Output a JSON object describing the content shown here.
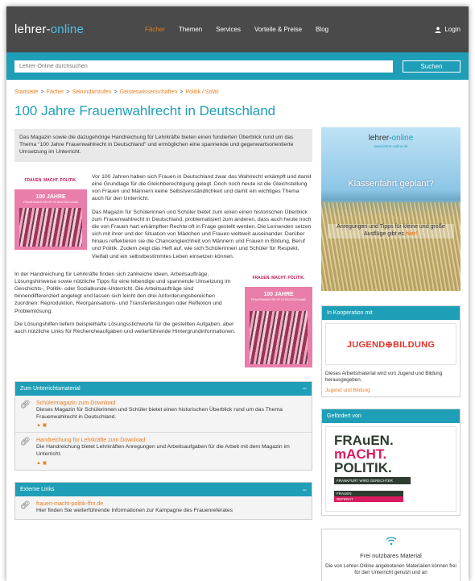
{
  "header": {
    "logo_part1": "lehrer-",
    "logo_part2": "online",
    "nav": [
      "Fächer",
      "Themen",
      "Services",
      "Vorteile & Preise",
      "Blog"
    ],
    "login_label": "Login"
  },
  "search": {
    "placeholder": "Lehrer-Online durchsuchen",
    "button_label": "Suchen"
  },
  "breadcrumb": [
    "Startseite",
    "Fächer",
    "Sekundarstufen",
    "Geisteswissenschaften",
    "Politik / SoWi"
  ],
  "page_title": "100 Jahre Frauenwahlrecht in Deutschland",
  "intro": "Das Magazin sowie die dazugehörige Handreichung für Lehrkräfte bieten einen fundierten Überblick rund um das Thema \"100 Jahre Frauenwahlrecht in Deutschland\" und ermöglichen eine spannende und gegenwartsorientierte Umsetzung im Unterricht.",
  "cover": {
    "logo": "FRAUEN. MACHT. POLITIK.",
    "title": "100 JAHRE",
    "subtitle": "FRAUENWAHLRECHT IN DEUTSCHLAND"
  },
  "paragraphs": [
    "Vor 100 Jahren haben sich Frauen in Deutschland zwar das Wahlrecht erkämpft und damit eine Grundlage für die Gleichberechtigung gelegt. Doch noch heute ist die Gleichstellung von Frauen und Männern keine Selbstverständlichkeit und damit ein wichtiges Thema auch für den Unterricht.",
    "Das Magazin für Schülerinnen und Schüler bietet zum einen einen historischen Überblick zum Frauenwahlrecht in Deutschland, problematisiert zum anderen, dass auch heute noch die von Frauen hart erkämpften Rechte oft in Frage gestellt werden. Die Lernenden setzen sich mit ihrer und der Situation von Mädchen und Frauen weltweit auseinander. Darüber hinaus reflektieren sie die Chancengleichheit von Männern und Frauen in Bildung, Beruf und Politik. Zudem zeigt das Heft auf, wie sich Schülerinnen und Schüler für Respekt, Vielfalt und ein selbstbestimmtes Leben einsetzen können.",
    "In der Handreichung für Lehrkräfte finden sich zahlreiche Ideen, Arbeitsaufträge, Lösungshinweise sowie nützliche Tipps für eine lebendige und spannende Umsetzung im Geschichts-, Politik- oder Sozialkunde-Unterricht. Die Arbeitsaufträge sind binnendifferenziert angelegt und lassen sich leicht den drei Anforderungsbereichen zuordnen: Reproduktion, Reorganisations- und Transferleistungen oder Reflexion und Problemlösung.",
    "Die Lösungshilfen liefern beispielhafte Lösungsstichworte für die gestellten Aufgaben, aber auch nützliche Links für Rechercheaufgaben und weiterführende Hintergrundinformationen."
  ],
  "materials": {
    "header": "Zum Unterrichtsmaterial",
    "items": [
      {
        "title": "Schülermagazin zum Download",
        "desc": "Dieses Magazin für Schülerinnen und Schüler bietet einen historischen Überblick rund um das Thema Frauenwahlrecht in Deutschland."
      },
      {
        "title": "Handreichung für Lehrkräfte zum Download",
        "desc": "Die Handreichung bietet Lehrkräften Anregungen und Arbeitsaufgaben für die Arbeit mit dem Magazin im Unterricht."
      }
    ]
  },
  "links": {
    "header": "Externe Links",
    "items": [
      {
        "title": "frauen-macht-politik-ffm.de",
        "desc": "Hier finden Sie weiterführende Informationen zur Kampagne des Frauenreferates"
      }
    ]
  },
  "ad": {
    "logo_part1": "lehrer-",
    "logo_part2": "online",
    "url": "www.lehrer-online.de",
    "headline": "Klassenfahrt geplant?",
    "text": "Anregungen und Tipps für kleine und große Ausflüge gibt es",
    "link_word": "hier!"
  },
  "cooperation": {
    "header": "In Kooperation mit",
    "logo": "JUGEND⊕BILDUNG",
    "text": "Dieses Arbeitsmaterial wird von Jugend und Bildung herausgegeben.",
    "link": "Jugend und Bildung"
  },
  "funded": {
    "header": "Gefördert von",
    "line1": "FRAuEN.",
    "line2": "mACHT.",
    "line3": "POLITIK.",
    "tagline": "FRANKFURT WIRD GERECHTER",
    "referat1": "FRAUEN",
    "referat2": "REFERAT"
  },
  "free": {
    "title": "Frei nutzbares Material",
    "text": "Die von Lehrer-Online angebotenen Materialien können frei für den Unterricht genutzt und an"
  }
}
